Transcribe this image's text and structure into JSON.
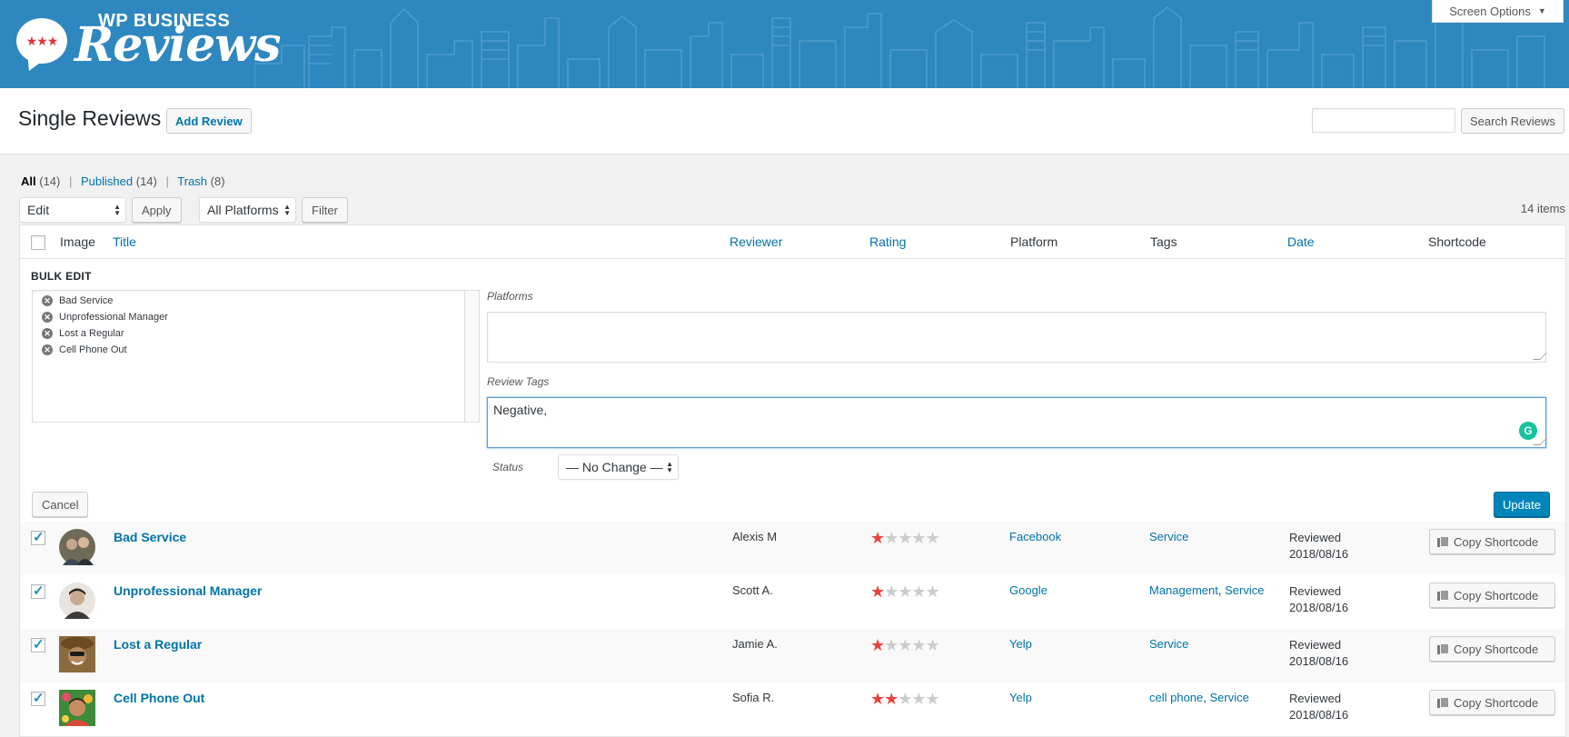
{
  "header": {
    "logo_small": "WP BUSINESS",
    "logo_big": "Reviews",
    "logo_stars": "★★★",
    "screen_options": "Screen Options"
  },
  "page": {
    "title": "Single Reviews",
    "add_button": "Add Review",
    "search_placeholder": "",
    "search_button": "Search Reviews"
  },
  "filters": {
    "all_label": "All",
    "all_count": "(14)",
    "published_label": "Published",
    "published_count": "(14)",
    "trash_label": "Trash",
    "trash_count": "(8)",
    "separator": "|"
  },
  "tablenav": {
    "bulk_action": "Edit",
    "apply": "Apply",
    "platform_filter": "All Platforms",
    "filter": "Filter",
    "items_count": "14 items"
  },
  "columns": {
    "image": "Image",
    "title": "Title",
    "reviewer": "Reviewer",
    "rating": "Rating",
    "platform": "Platform",
    "tags": "Tags",
    "date": "Date",
    "shortcode": "Shortcode"
  },
  "bulk_edit": {
    "title": "BULK EDIT",
    "items": [
      "Bad Service",
      "Unprofessional Manager",
      "Lost a Regular",
      "Cell Phone Out"
    ],
    "platforms_label": "Platforms",
    "platforms_value": "",
    "tags_label": "Review Tags",
    "tags_value": "Negative,",
    "status_label": "Status",
    "status_value": "— No Change —",
    "cancel": "Cancel",
    "update": "Update"
  },
  "rows": [
    {
      "title": "Bad Service",
      "reviewer": "Alexis M",
      "rating": 1,
      "platform": "Facebook",
      "tag1": "Service",
      "tag_sep": "",
      "tag2": "",
      "date_label": "Reviewed",
      "date": "2018/08/16",
      "button": "Copy Shortcode"
    },
    {
      "title": "Unprofessional Manager",
      "reviewer": "Scott A.",
      "rating": 1,
      "platform": "Google",
      "tag1": "Management",
      "tag_sep": ", ",
      "tag2": "Service",
      "date_label": "Reviewed",
      "date": "2018/08/16",
      "button": "Copy Shortcode"
    },
    {
      "title": "Lost a Regular",
      "reviewer": "Jamie A.",
      "rating": 1,
      "platform": "Yelp",
      "tag1": "Service",
      "tag_sep": "",
      "tag2": "",
      "date_label": "Reviewed",
      "date": "2018/08/16",
      "button": "Copy Shortcode"
    },
    {
      "title": "Cell Phone Out",
      "reviewer": "Sofia R.",
      "rating": 2,
      "platform": "Yelp",
      "tag1": "cell phone",
      "tag_sep": ", ",
      "tag2": "Service",
      "date_label": "Reviewed",
      "date": "2018/08/16",
      "button": "Copy Shortcode"
    }
  ],
  "colors": {
    "banner": "#2e87bf",
    "link": "#0073aa",
    "star_on": "#e9423b",
    "star_off": "#cccccc",
    "primary_button": "#0085ba"
  }
}
